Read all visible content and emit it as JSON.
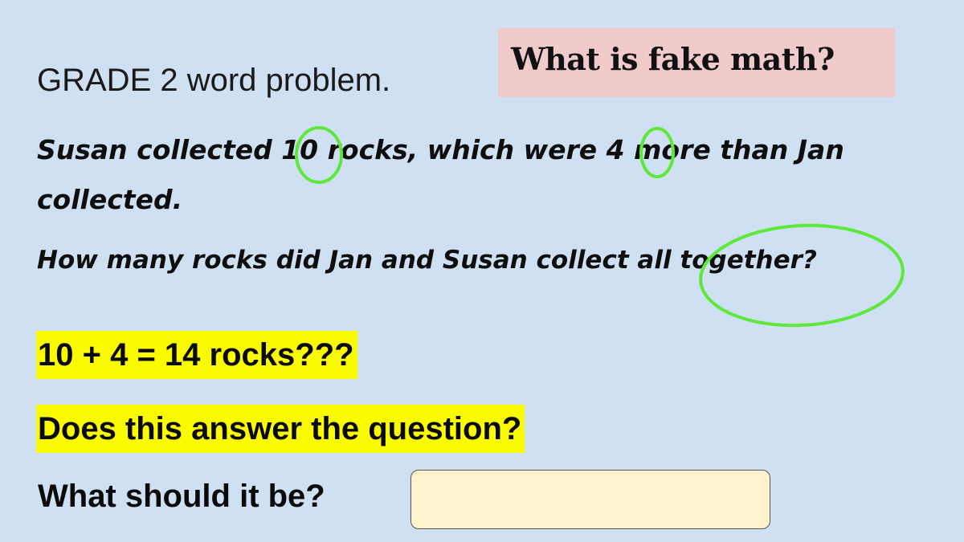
{
  "slide": {
    "grade_label": "GRADE 2 word problem.",
    "callout": "What is fake math?",
    "problem": {
      "line1": "Susan collected 10 rocks, which were 4 more than Jan",
      "line2": "collected.",
      "question": "How many rocks did Jan and Susan collect all together?"
    },
    "equation": "10 + 4 = 14 rocks???",
    "prompt": "Does this answer the question?",
    "answer_label": "What should it be?",
    "answer_value": ""
  },
  "colors": {
    "background": "#cfe0f3",
    "callout_bg": "#f1cbcb",
    "highlight": "#fbfb00",
    "annotation_circle": "#5ee83a",
    "answer_box_bg": "#fff2cc"
  }
}
